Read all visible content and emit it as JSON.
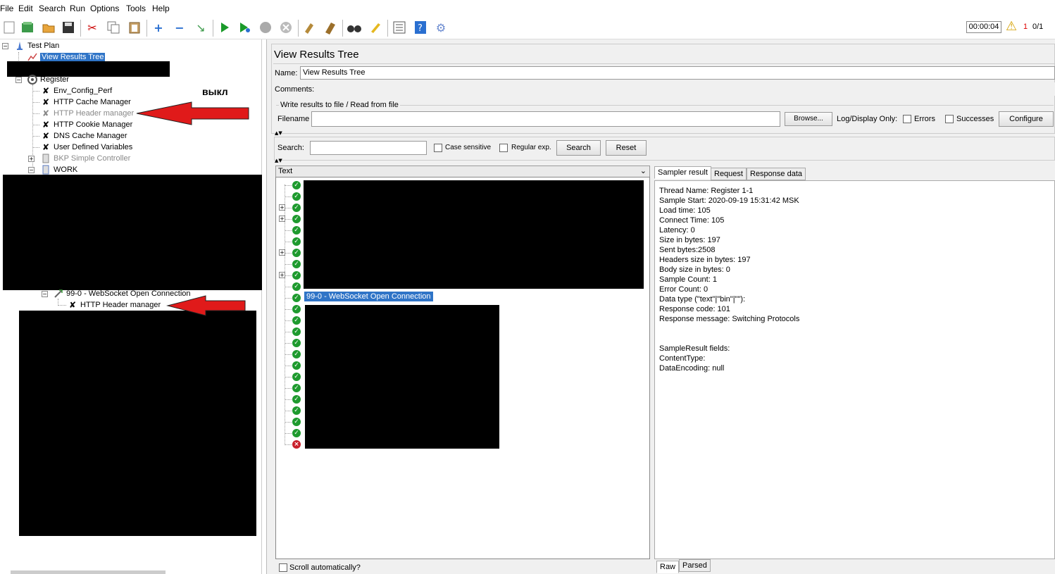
{
  "menu": [
    "File",
    "Edit",
    "Search",
    "Run",
    "Options",
    "Tools",
    "Help"
  ],
  "toolbar": {
    "timer": "00:00:04",
    "warnings": "1",
    "threads": "0/1"
  },
  "tree": {
    "test_plan": "Test Plan",
    "view_results_tree": "View Results Tree",
    "register": "Register",
    "env_config": "Env_Config_Perf",
    "cache_manager": "HTTP Cache Manager",
    "header_manager_disabled": "HTTP Header manager",
    "cookie_manager": "HTTP Cookie Manager",
    "dns_manager": "DNS Cache Manager",
    "user_vars": "User Defined Variables",
    "bkp_controller": "BKP Simple Controller",
    "work": "WORK",
    "ws_open": "99-0 - WebSocket Open Connection",
    "ws_header_manager": "HTTP Header manager",
    "annotation": "выкл"
  },
  "listener": {
    "title": "View Results Tree",
    "name_label": "Name:",
    "name_value": "View Results Tree",
    "comments_label": "Comments:",
    "write_results": "Write results to file / Read from file",
    "filename_label": "Filename",
    "filename_value": "",
    "browse": "Browse...",
    "log_display_only": "Log/Display Only:",
    "errors": "Errors",
    "successes": "Successes",
    "configure": "Configure"
  },
  "search": {
    "label": "Search:",
    "value": "",
    "case_sensitive": "Case sensitive",
    "regular_exp": "Regular exp.",
    "search_btn": "Search",
    "reset_btn": "Reset"
  },
  "results": {
    "renderer": "Text",
    "selected": "99-0 - WebSocket Open Connection",
    "scroll_auto": "Scroll automatically?"
  },
  "tabs": {
    "sampler_result": "Sampler result",
    "request": "Request",
    "response_data": "Response data",
    "raw": "Raw",
    "parsed": "Parsed"
  },
  "details": [
    "Thread Name: Register 1-1",
    "Sample Start: 2020-09-19 15:31:42 MSK",
    "Load time: 105",
    "Connect Time: 105",
    "Latency: 0",
    "Size in bytes: 197",
    "Sent bytes:2508",
    "Headers size in bytes: 197",
    "Body size in bytes: 0",
    "Sample Count: 1",
    "Error Count: 0",
    "Data type (\"text\"|\"bin\"|\"\"): ",
    "Response code: 101",
    "Response message: Switching Protocols",
    "",
    "",
    "SampleResult fields:",
    "ContentType: ",
    "DataEncoding: null"
  ]
}
